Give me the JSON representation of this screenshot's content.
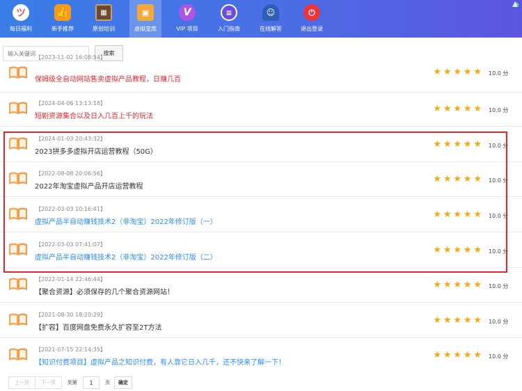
{
  "nav": {
    "items": [
      {
        "label": "每日福利",
        "icon": "lucky-cat-icon",
        "active": false
      },
      {
        "label": "新手推荐",
        "icon": "thumbs-up-icon",
        "active": false
      },
      {
        "label": "原创培训",
        "icon": "chalkboard-icon",
        "active": false
      },
      {
        "label": "虚拟宝库",
        "icon": "treasure-chest-icon",
        "active": true
      },
      {
        "label": "VIP 项目",
        "icon": "vip-badge-icon",
        "active": false
      },
      {
        "label": "入门指南",
        "icon": "guide-book-icon",
        "active": false
      },
      {
        "label": "在线解答",
        "icon": "support-agent-icon",
        "active": false
      },
      {
        "label": "退出登录",
        "icon": "power-icon",
        "active": false
      }
    ]
  },
  "search": {
    "placeholder": "输入关键词",
    "button_label": "搜索"
  },
  "list": {
    "items": [
      {
        "time": "【2023-11-02 16:08:54】",
        "title": "保姆级全自动网站售卖虚拟产品教程，日赚几百",
        "title_color": "#e0282e",
        "rating": 5,
        "score": "10.0 分"
      },
      {
        "time": "【2024-04-06 13:13:18】",
        "title": "短剧资源集合以及日入几百上千的玩法",
        "title_color": "#e0282e",
        "rating": 5,
        "score": "10.0 分"
      },
      {
        "time": "【2024-01-03 20:43:32】",
        "title": "2023拼多多虚拟开店运营教程（50G）",
        "title_color": "#333333",
        "rating": 5,
        "score": "10.0 分"
      },
      {
        "time": "【2022-08-08 20:06:56】",
        "title": "2022年淘宝虚拟产品开店运营教程",
        "title_color": "#333333",
        "rating": 5,
        "score": "10.0 分"
      },
      {
        "time": "【2022-03-03 10:16:41】",
        "title": "虚拟产品半自动赚钱技术2（非淘宝）2022年修订版（一）",
        "title_color": "#2d8cf0",
        "rating": 5,
        "score": "10.0 分"
      },
      {
        "time": "【2022-03-03 07:41:07】",
        "title": "虚拟产品半自动赚钱技术2（非淘宝）2022年修订版（二）",
        "title_color": "#2d8cf0",
        "rating": 5,
        "score": "10.0 分"
      },
      {
        "time": "【2022-01-14 22:46:44】",
        "title": "【聚合资源】必须保存的几个聚合资源网站！",
        "title_color": "#333333",
        "rating": 5,
        "score": "10.0 分"
      },
      {
        "time": "【2021-08-30 18:20:29】",
        "title": "【扩容】百度网盘免费永久扩容至2T方法",
        "title_color": "#333333",
        "rating": 5,
        "score": "10.0 分"
      },
      {
        "time": "【2021-07-15 22:14:35】",
        "title": "【知识付费项目】虚拟产品之知识付费，有人靠它日入几千，还不快来了解一下！",
        "title_color": "#2d8cf0",
        "rating": 5,
        "score": "10.0 分"
      }
    ]
  },
  "pagination": {
    "prev_label": "上一页",
    "next_label": "下一页",
    "goto_label": "到第",
    "page_value": "1",
    "page_unit": "页",
    "confirm_label": "确定"
  },
  "colors": {
    "nav_gradient_start": "#3a7de6",
    "nav_gradient_end": "#5c55e0",
    "star": "#f5a815",
    "highlight": "#e8232a"
  }
}
